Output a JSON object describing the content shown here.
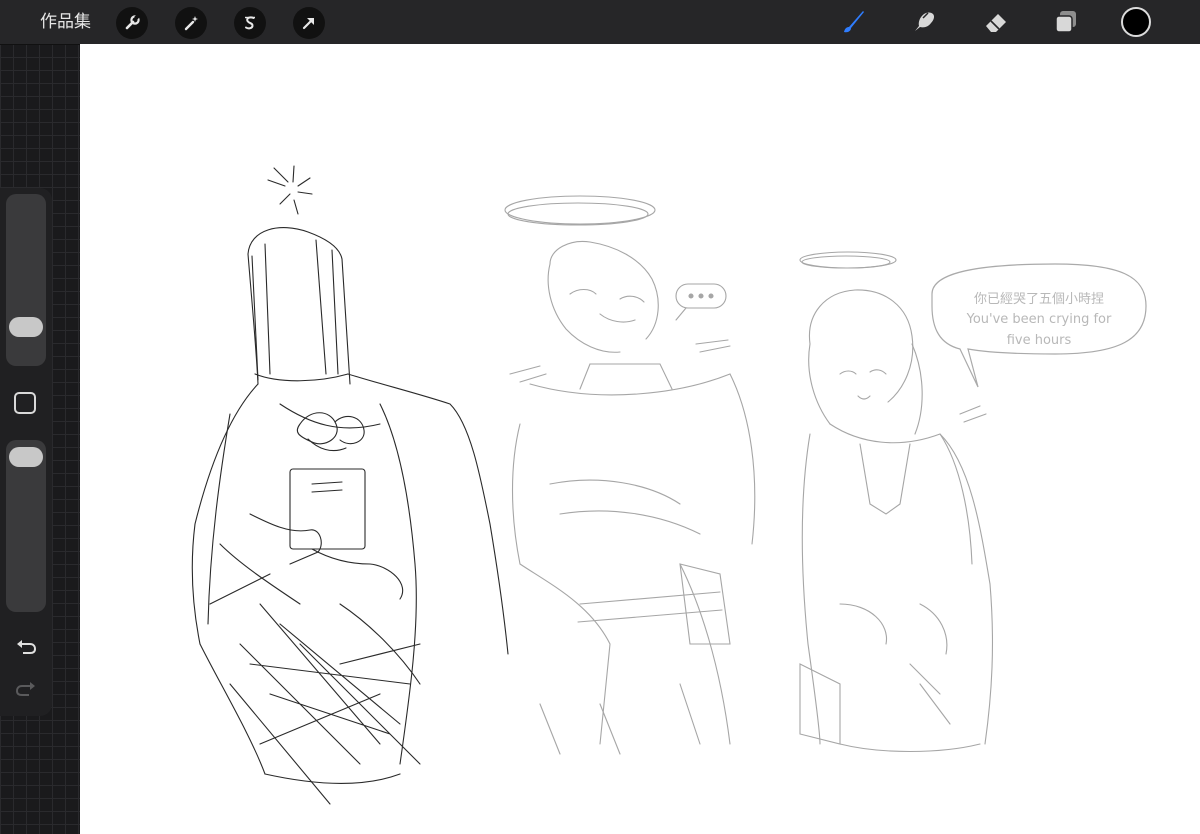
{
  "toolbar": {
    "gallery_label": "作品集",
    "left_tools": [
      "wrench-icon",
      "magic-wand-icon",
      "selection-s-icon",
      "transform-arrow-icon"
    ],
    "right_tools": [
      "brush-icon",
      "smudge-icon",
      "eraser-icon",
      "layers-icon"
    ],
    "active_tool": "brush-icon",
    "active_color": "#000000",
    "accent_color": "#2f7dff"
  },
  "sidebar": {
    "brush_size_level": 0.18,
    "opacity_level": 0.97,
    "icons": [
      "modify-square-icon",
      "undo-icon",
      "redo-icon"
    ]
  },
  "canvas": {
    "speech_bubble": {
      "line1": "你已經哭了五個小時捏",
      "line2": "You've been crying for",
      "line3": "five hours"
    }
  }
}
